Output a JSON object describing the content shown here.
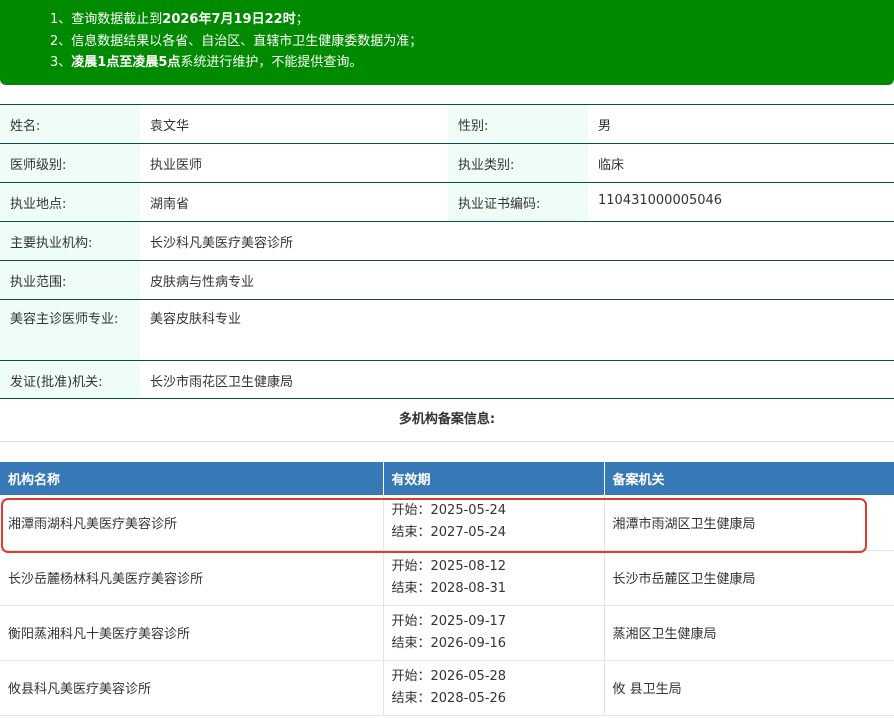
{
  "notice": {
    "line1_prefix": "1、查询数据截止到",
    "line1_bold": "2026年7月19日22时",
    "line1_suffix": "；",
    "line2": "2、信息数据结果以各省、自治区、直辖市卫生健康委数据为准；",
    "line3_prefix": "3、",
    "line3_bold": "凌晨1点至凌晨5点",
    "line3_suffix": "系统进行维护，不能提供查询。"
  },
  "doctor": {
    "name_label": "姓名:",
    "name": "袁文华",
    "gender_label": "性别:",
    "gender": "男",
    "level_label": "医师级别:",
    "level": "执业医师",
    "category_label": "执业类别:",
    "category": "临床",
    "location_label": "执业地点:",
    "location": "湖南省",
    "cert_label": "执业证书编码:",
    "cert": "110431000005046",
    "institution_label": "主要执业机构:",
    "institution": "长沙科凡美医疗美容诊所",
    "scope_label": "执业范围:",
    "scope": "皮肤病与性病专业",
    "specialty_label": "美容主诊医师专业:",
    "specialty": "美容皮肤科专业",
    "issuer_label": "发证(批准)机关:",
    "issuer": "长沙市雨花区卫生健康局"
  },
  "multi_title": "多机构备案信息:",
  "registrations": {
    "headers": [
      "机构名称",
      "有效期",
      "备案机关"
    ],
    "rows": [
      {
        "org": "湘潭雨湖科凡美医疗美容诊所",
        "start": "开始：2025-05-24",
        "end": "结束：2027-05-24",
        "authority": "湘潭市雨湖区卫生健康局"
      },
      {
        "org": "长沙岳麓杨林科凡美医疗美容诊所",
        "start": "开始：2025-08-12",
        "end": "结束：2028-08-31",
        "authority": "长沙市岳麓区卫生健康局"
      },
      {
        "org": "衡阳蒸湘科凡十美医疗美容诊所",
        "start": "开始：2025-09-17",
        "end": "结束：2026-09-16",
        "authority": "蒸湘区卫生健康局"
      },
      {
        "org": "攸县科凡美医疗美容诊所",
        "start": "开始：2026-05-28",
        "end": "结束：2028-05-26",
        "authority": "攸 县卫生局"
      }
    ]
  },
  "colors": {
    "notice_bg": "#008a00",
    "header_bg": "#3778b7",
    "label_bg": "#eefdf6",
    "highlight": "#e03a2f"
  }
}
